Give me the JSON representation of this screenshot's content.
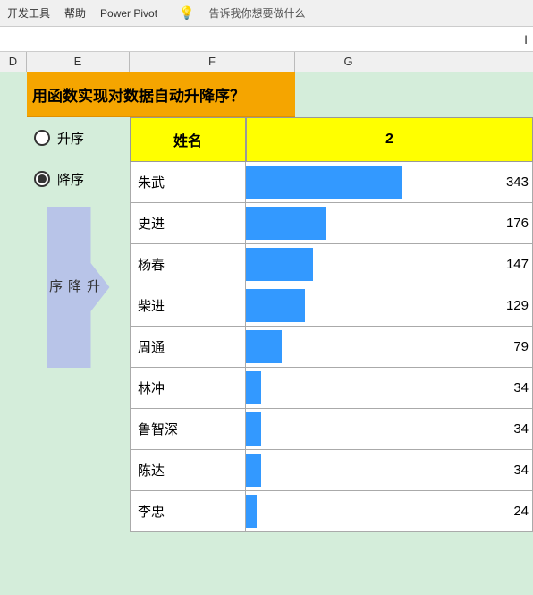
{
  "menubar": {
    "items": [
      "开发工具",
      "帮助",
      "Power Pivot"
    ],
    "lightbulb": "💡",
    "prompt": "告诉我你想要做什么"
  },
  "cursor": "I",
  "columns": {
    "headers": [
      "D",
      "E",
      "F",
      "G"
    ],
    "widths": [
      30,
      115,
      185,
      120
    ]
  },
  "title": {
    "text": "用函数实现对数据自动升降序？"
  },
  "radio": {
    "ascending_label": "升序",
    "descending_label": "降序"
  },
  "arrow_label": "升\n降\n序",
  "table": {
    "header": {
      "col1": "姓名",
      "col2": "2"
    },
    "rows": [
      {
        "name": "朱武",
        "value": 343
      },
      {
        "name": "史进",
        "value": 176
      },
      {
        "name": "杨春",
        "value": 147
      },
      {
        "name": "柴进",
        "value": 129
      },
      {
        "name": "周通",
        "value": 79
      },
      {
        "name": "林冲",
        "value": 34
      },
      {
        "name": "鲁智深",
        "value": 34
      },
      {
        "name": "陈达",
        "value": 34
      },
      {
        "name": "李忠",
        "value": 24
      }
    ],
    "max_value": 343
  }
}
